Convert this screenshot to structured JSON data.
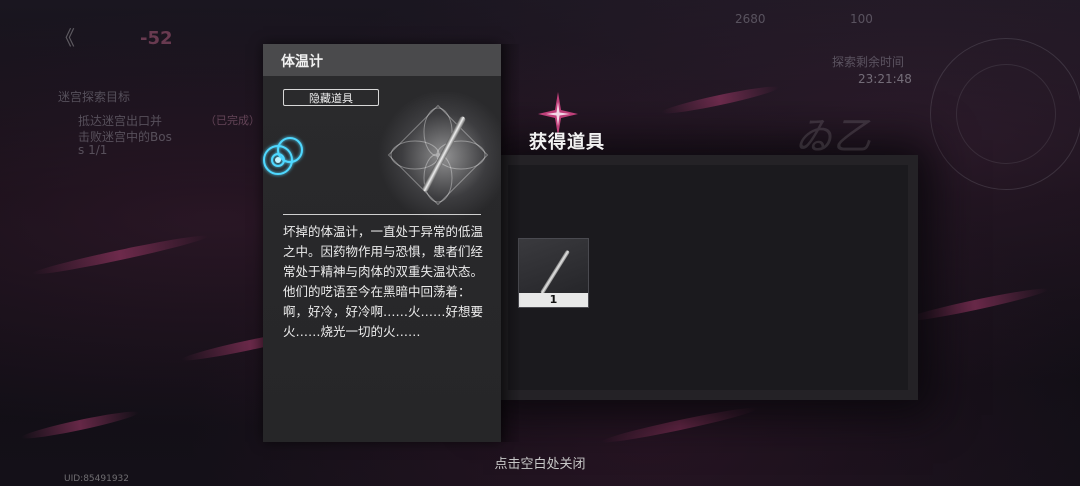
{
  "hud": {
    "back_glyph": "《",
    "level_text": "-52",
    "resource_1": "2680",
    "resource_2": "100",
    "timer_label": "探索剩余时间",
    "timer_value": "23:21:48",
    "objectives_title": "迷宫探索目标",
    "objective_1": "抵达迷宫出口并",
    "objective_1_status": "（已完成）",
    "objective_2": "击败迷宫中的Bos",
    "objective_2_progress": "s 1/1",
    "uid": "UID:85491932"
  },
  "reward": {
    "title": "获得道具",
    "decor_text": "ゐ乙",
    "item_count": "1",
    "close_hint": "点击空白处关闭"
  },
  "item_detail": {
    "name": "体温计",
    "tag": "隐藏道具",
    "description": "坏掉的体温计，一直处于异常的低温之中。因药物作用与恐惧，患者们经常处于精神与肉体的双重失温状态。他们的呓语至今在黑暗中回荡着：啊，好冷，好冷啊……火……好想要火……烧光一切的火……"
  },
  "colors": {
    "panel_header": "#4a4a4c",
    "panel_body": "#2b2b2d",
    "accent_pink": "#c0407a",
    "rarity_glow": "#4fd8ff"
  }
}
